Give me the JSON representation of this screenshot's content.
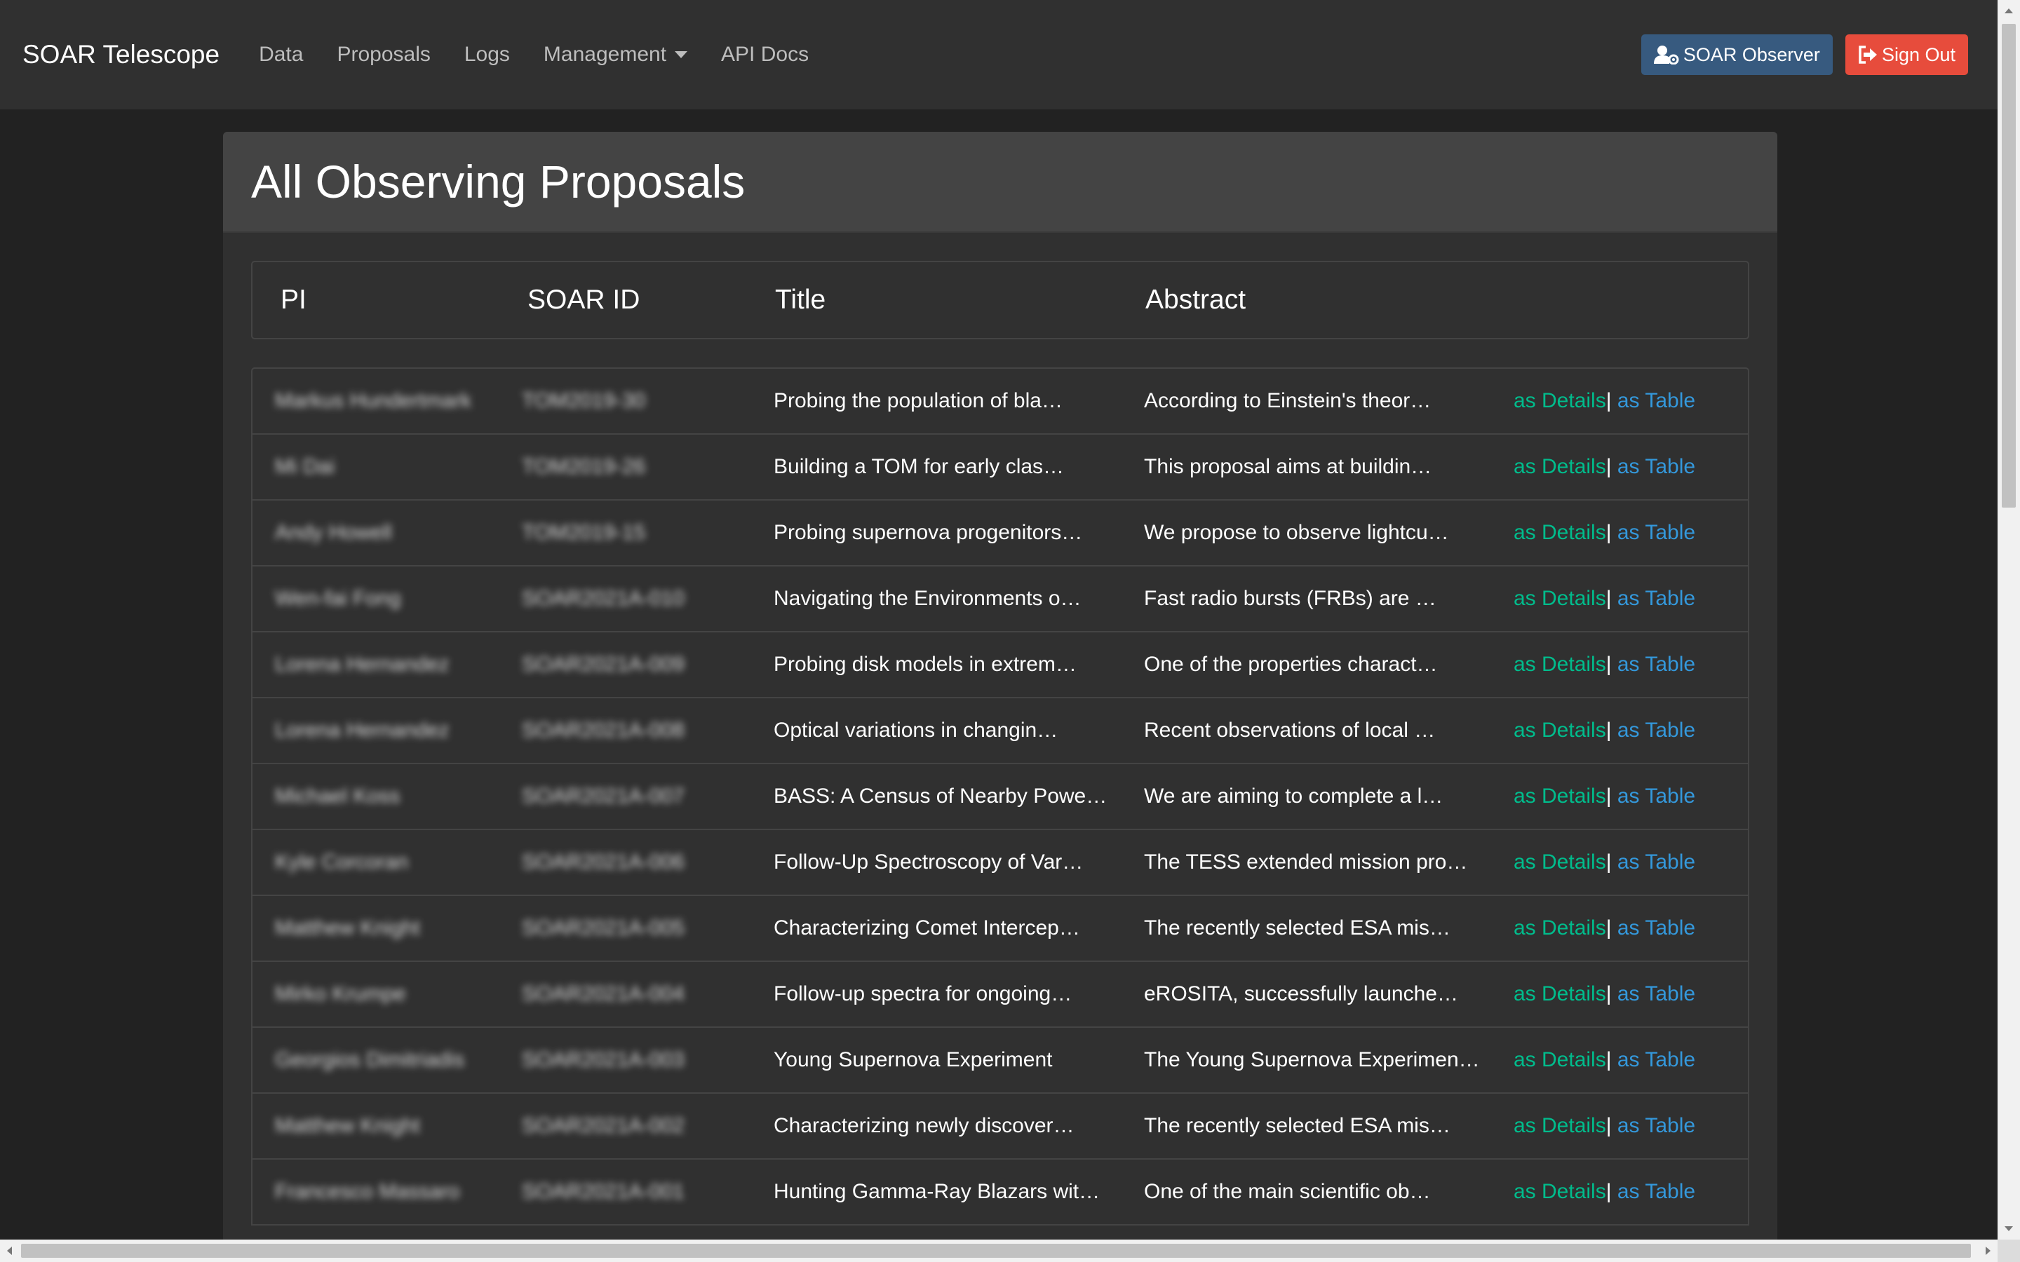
{
  "navbar": {
    "brand": "SOAR Telescope",
    "links": [
      "Data",
      "Proposals",
      "Logs",
      "Management",
      "API Docs"
    ],
    "observer_button": "SOAR Observer",
    "signout_button": "Sign Out"
  },
  "page": {
    "title": "All Observing Proposals"
  },
  "table": {
    "headers": [
      "PI",
      "SOAR ID",
      "Title",
      "Abstract"
    ],
    "rows": [
      {
        "pi": "Markus Hundertmark",
        "id": "TOM2019-30",
        "title": "Probing the population of bla…",
        "abstract": "According to Einstein's theor…"
      },
      {
        "pi": "Mi Dai",
        "id": "TOM2019-26",
        "title": "Building a TOM for early clas…",
        "abstract": "This proposal aims at buildin…"
      },
      {
        "pi": "Andy Howell",
        "id": "TOM2019-15",
        "title": "Probing supernova progenitors…",
        "abstract": "We propose to observe lightcu…"
      },
      {
        "pi": "Wen-fai Fong",
        "id": "SOAR2021A-010",
        "title": "Navigating the Environments o…",
        "abstract": "Fast radio bursts (FRBs) are …"
      },
      {
        "pi": "Lorena Hernandez",
        "id": "SOAR2021A-009",
        "title": "Probing disk models in extrem…",
        "abstract": "One of the properties charact…"
      },
      {
        "pi": "Lorena Hernandez",
        "id": "SOAR2021A-008",
        "title": "Optical variations in changin…",
        "abstract": "Recent observations of local …"
      },
      {
        "pi": "Michael Koss",
        "id": "SOAR2021A-007",
        "title": "BASS: A Census of Nearby Powe…",
        "abstract": "We are aiming to complete a l…"
      },
      {
        "pi": "Kyle Corcoran",
        "id": "SOAR2021A-006",
        "title": "Follow-Up Spectroscopy of Var…",
        "abstract": "The TESS extended mission pro…"
      },
      {
        "pi": "Matthew Knight",
        "id": "SOAR2021A-005",
        "title": "Characterizing Comet Intercep…",
        "abstract": "The recently selected ESA mis…"
      },
      {
        "pi": "Mirko Krumpe",
        "id": "SOAR2021A-004",
        "title": "Follow-up spectra for ongoing…",
        "abstract": "eROSITA, successfully launche…"
      },
      {
        "pi": "Georgios Dimitriadis",
        "id": "SOAR2021A-003",
        "title": "Young Supernova Experiment",
        "abstract": "The Young Supernova Experimen…"
      },
      {
        "pi": "Matthew Knight",
        "id": "SOAR2021A-002",
        "title": "Characterizing newly discover…",
        "abstract": "The recently selected ESA mis…"
      },
      {
        "pi": "Francesco Massaro",
        "id": "SOAR2021A-001",
        "title": "Hunting Gamma-Ray Blazars wit…",
        "abstract": "One of the main scientific ob…"
      }
    ],
    "link_details": "as Details",
    "link_separator": "|",
    "link_table": "as Table"
  },
  "colors": {
    "background": "#222222",
    "navbar": "#303030",
    "observer_button": "#375a7f",
    "signout_button": "#e74c3c",
    "details_link": "#00bc8c",
    "table_link": "#3498db"
  }
}
